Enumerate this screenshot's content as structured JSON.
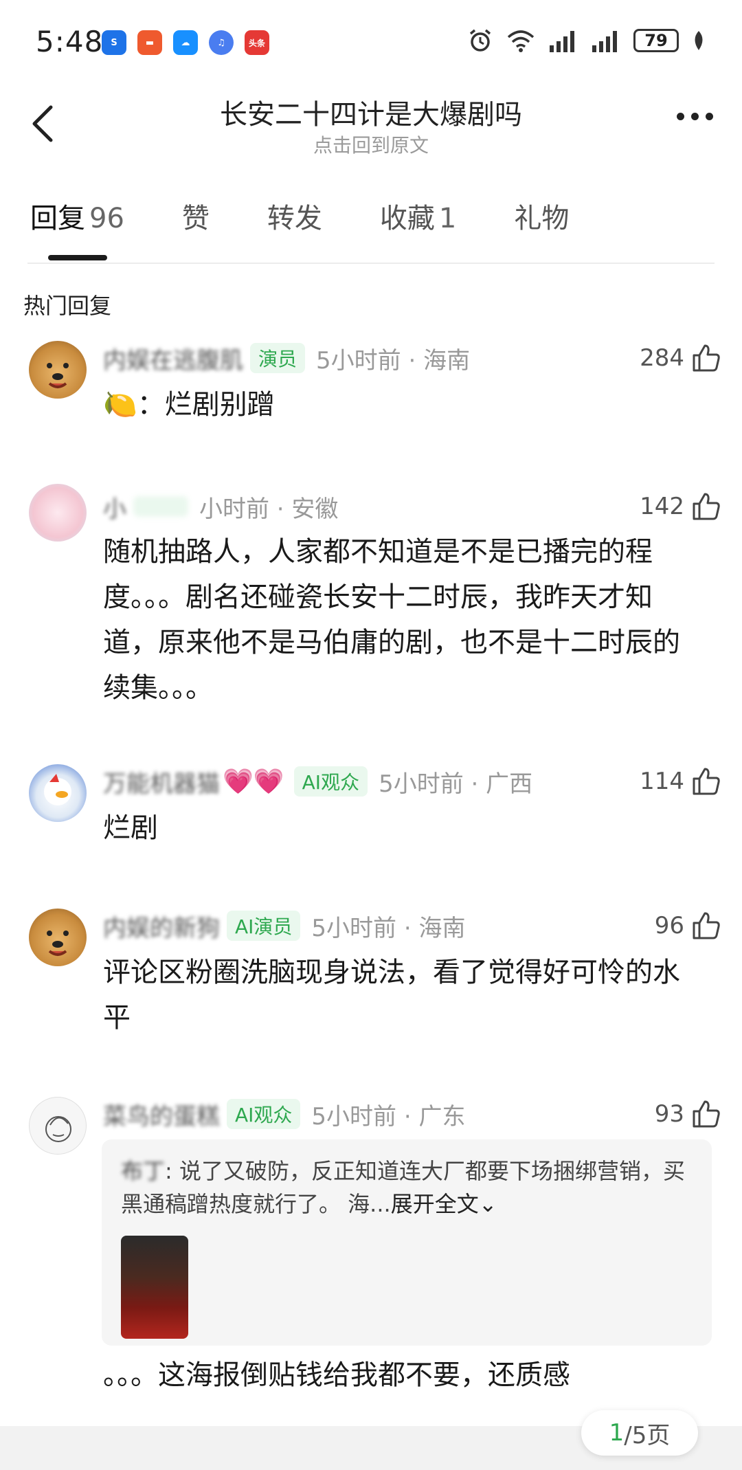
{
  "status": {
    "time": "5:48",
    "battery": "79",
    "apps": [
      {
        "icon": "app-blue-icon",
        "color": "#1e73e8",
        "glyph": "S"
      },
      {
        "icon": "app-orange-icon",
        "color": "#ef5a2e",
        "glyph": "▬"
      },
      {
        "icon": "app-cloud-icon",
        "color": "#1890ff",
        "glyph": "☁"
      },
      {
        "icon": "music-icon",
        "color": "#4a7df0",
        "glyph": "♫"
      },
      {
        "icon": "toutiao-icon",
        "color": "#e53935",
        "glyph": "头条"
      }
    ]
  },
  "header": {
    "title": "长安二十四计是大爆剧吗",
    "subtitle": "点击回到原文"
  },
  "tabs": [
    {
      "label": "回复",
      "count": "96"
    },
    {
      "label": "赞",
      "count": ""
    },
    {
      "label": "转发",
      "count": ""
    },
    {
      "label": "收藏",
      "count": "1"
    },
    {
      "label": "礼物",
      "count": ""
    }
  ],
  "section_title": "热门回复",
  "comments": [
    {
      "username": "内娱在逃腹肌",
      "badge": "演员",
      "time_loc": "5小时前 · 海南",
      "likes": "284",
      "text": "🍋：烂剧别蹭"
    },
    {
      "username": "小",
      "badge": "",
      "time_loc": "小时前 · 安徽",
      "likes": "142",
      "text": "随机抽路人，人家都不知道是不是已播完的程度。。。剧名还碰瓷长安十二时辰，我昨天才知道，原来他不是马伯庸的剧，也不是十二时辰的续集。。。"
    },
    {
      "username": "万能机器猫",
      "hearts": "💗💗",
      "badge": "AI观众",
      "time_loc": "5小时前 · 广西",
      "likes": "114",
      "text": "烂剧"
    },
    {
      "username": "内娱的新狗",
      "badge": "AI演员",
      "time_loc": "5小时前 · 海南",
      "likes": "96",
      "text": "评论区粉圈洗脑现身说法，看了觉得好可怜的水平"
    },
    {
      "username": "菜鸟的蛋糕",
      "badge": "AI观众",
      "time_loc": "5小时前 · 广东",
      "likes": "93",
      "quote": {
        "author": "布丁",
        "text": ": 说了又破防，反正知道连大厂都要下场捆绑营销，买黑通稿蹭热度就行了。 海...",
        "expand": "展开全文"
      },
      "text": "。。。这海报倒贴钱给我都不要，还质感"
    }
  ],
  "pager": {
    "current": "1",
    "total_suffix": "/5页"
  }
}
